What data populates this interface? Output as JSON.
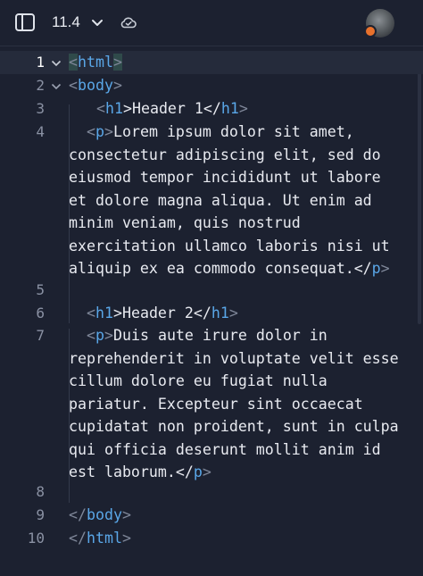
{
  "toolbar": {
    "version": "11.4",
    "icons": [
      "sidebar-icon",
      "chevron-down-icon",
      "cloud-check-icon",
      "avatar"
    ],
    "accent": "#e8712c"
  },
  "editor": {
    "line_numbers": [
      "1",
      "2",
      "3",
      "4",
      "5",
      "6",
      "7",
      "8",
      "9",
      "10"
    ],
    "colors": {
      "tag": "#5aa7e8",
      "bracket": "#7f8799",
      "text": "#e8eaf0",
      "background": "#1c2130"
    },
    "lines": {
      "l1": {
        "open": "<",
        "tag": "html",
        "close": ">"
      },
      "l2": {
        "open": "<",
        "tag": "body",
        "close": ">"
      },
      "l3": {
        "open": "<",
        "tag": "h1",
        "mid": ">Header 1</",
        "tag2": "h1",
        "close": ">"
      },
      "l4": {
        "open": "<",
        "tag": "p",
        "mid": ">",
        "text1": "Lorem ipsum dolor sit amet,",
        "wraps": [
          "consectetur adipiscing elit, sed do",
          "eiusmod tempor incididunt ut labore",
          "et dolore magna aliqua. Ut enim ad",
          "minim veniam, quis nostrud",
          "exercitation ullamco laboris nisi ut"
        ],
        "last": "aliquip ex ea commodo consequat.</",
        "tag2": "p",
        "close": ">"
      },
      "l6": {
        "open": "<",
        "tag": "h1",
        "mid": ">Header 2</",
        "tag2": "h1",
        "close": ">"
      },
      "l7": {
        "open": "<",
        "tag": "p",
        "mid": ">",
        "text1": "Duis aute irure dolor in",
        "wraps": [
          "reprehenderit in voluptate velit esse",
          "cillum dolore eu fugiat nulla",
          "pariatur. Excepteur sint occaecat",
          "cupidatat non proident, sunt in culpa",
          "qui officia deserunt mollit anim id"
        ],
        "last": "est laborum.</",
        "tag2": "p",
        "close": ">"
      },
      "l9": {
        "open": "</",
        "tag": "body",
        "close": ">"
      },
      "l10": {
        "open": "</",
        "tag": "html",
        "close": ">"
      }
    }
  }
}
